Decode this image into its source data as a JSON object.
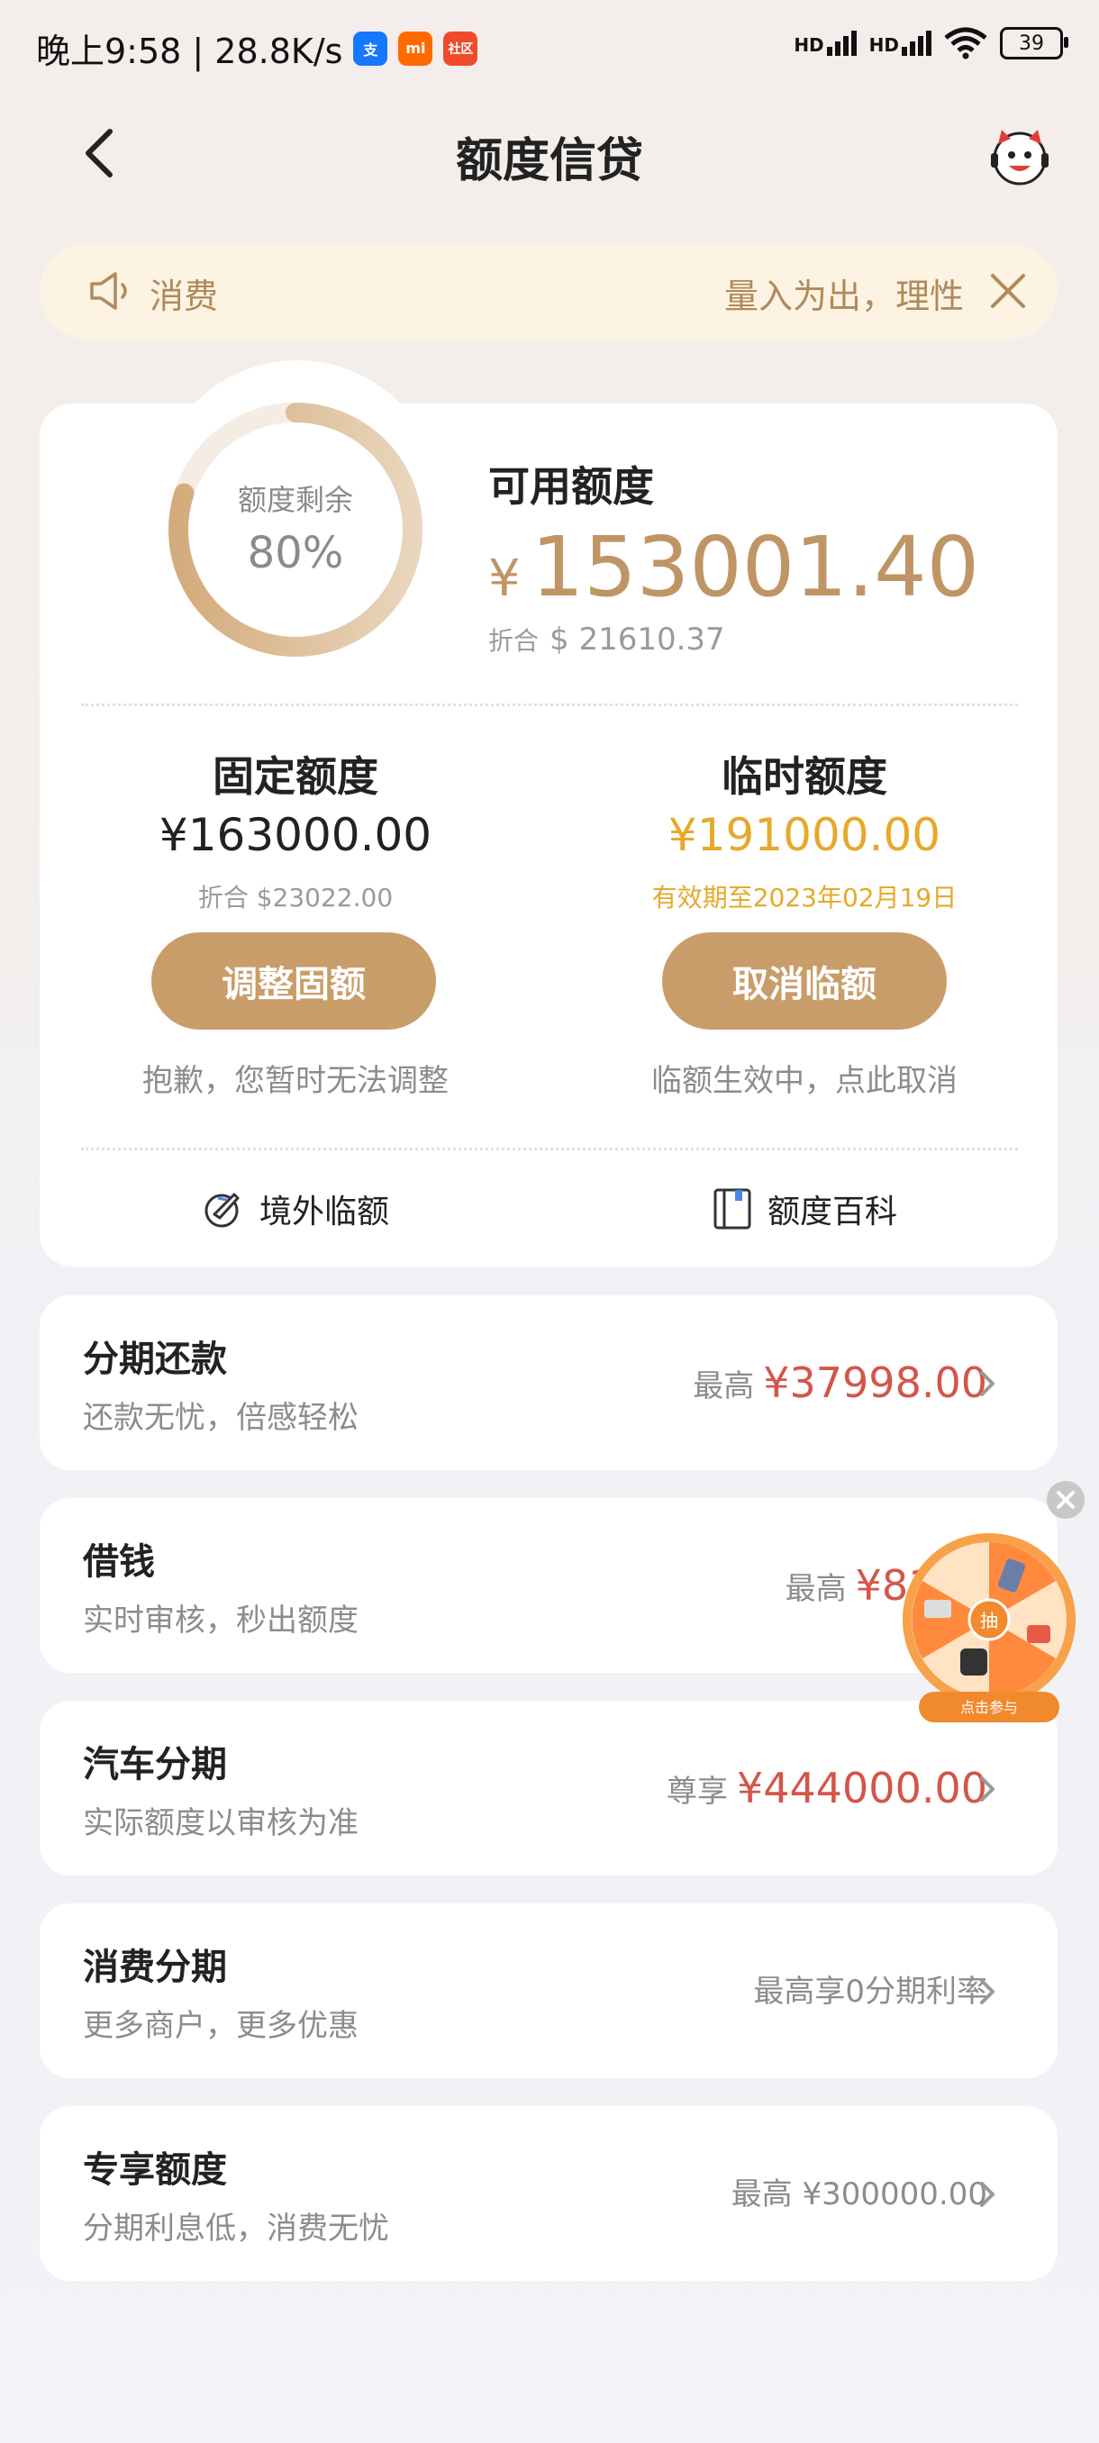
{
  "status_bar": {
    "time_speed": "晚上9:58 | 28.8K/s",
    "signal_1": "HD",
    "signal_2": "HD",
    "battery": "39",
    "badge_mi": "mi",
    "badge_community": "社区"
  },
  "header": {
    "title": "额度信贷"
  },
  "notice": {
    "label": "消费",
    "message": "量入为出，理性"
  },
  "summary": {
    "ring_label": "额度剩余",
    "ring_percent": "80%",
    "ring_fraction": 0.8,
    "available_label": "可用额度",
    "available_currency": "¥",
    "available_amount": "153001.40",
    "converted_label": "折合",
    "converted_value": "$ 21610.37"
  },
  "fixed": {
    "title": "固定额度",
    "amount": "¥163000.00",
    "converted": "折合 $23022.00",
    "button": "调整固额",
    "note": "抱歉，您暂时无法调整"
  },
  "temporary": {
    "title": "临时额度",
    "amount": "¥191000.00",
    "validity_prefix": "有效期至",
    "validity_date": "2023年02月19日",
    "button": "取消临额",
    "note": "临额生效中，点此取消"
  },
  "links": {
    "overseas": "境外临额",
    "encyclopedia": "额度百科"
  },
  "rows": [
    {
      "title": "分期还款",
      "subtitle": "还款无忧，倍感轻松",
      "prefix": "最高",
      "value": "¥37998.00"
    },
    {
      "title": "借钱",
      "subtitle": "实时审核，秒出额度",
      "prefix": "最高",
      "value": "¥8150"
    },
    {
      "title": "汽车分期",
      "subtitle": "实际额度以审核为准",
      "prefix": "尊享",
      "value": "¥444000.00"
    },
    {
      "title": "消费分期",
      "subtitle": "更多商户，更多优惠",
      "prefix": "最高享0分期利率",
      "value": ""
    },
    {
      "title": "专享额度",
      "subtitle": "分期利息低，消费无忧",
      "prefix": "最高 ¥300000.00",
      "value": ""
    }
  ],
  "wheel": {
    "center": "抽",
    "cta": "点击参与"
  },
  "colors": {
    "accent": "#c99d69",
    "gold": "#e6a92a",
    "red": "#d4554a"
  }
}
